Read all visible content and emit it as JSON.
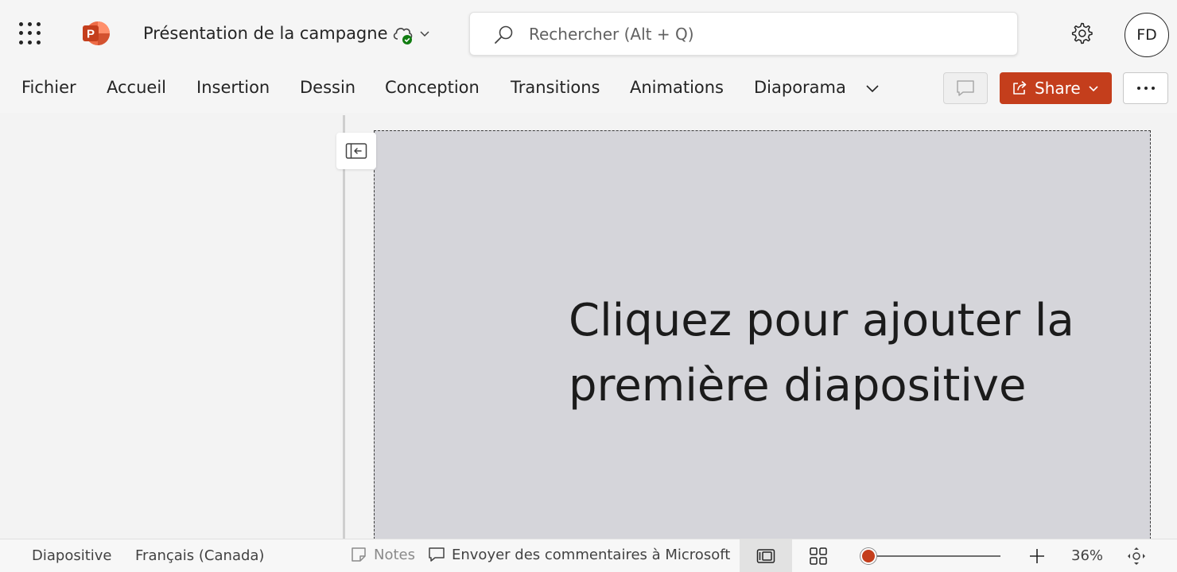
{
  "app": {
    "document_title": "Présentation de la campagne",
    "user_initials": "FD",
    "brand_color": "#c43e1c"
  },
  "search": {
    "placeholder": "Rechercher (Alt + Q)",
    "value": ""
  },
  "ribbon": {
    "tabs": [
      {
        "label": "Fichier"
      },
      {
        "label": "Accueil"
      },
      {
        "label": "Insertion"
      },
      {
        "label": "Dessin"
      },
      {
        "label": "Conception"
      },
      {
        "label": "Transitions"
      },
      {
        "label": "Animations"
      },
      {
        "label": "Diaporama"
      }
    ],
    "share_label": "Share"
  },
  "slide": {
    "title_placeholder": "Cliquez pour ajouter la première diapositive"
  },
  "status": {
    "slide_label": "Diapositive",
    "language": "Français (Canada)",
    "notes_label": "Notes",
    "feedback_label": "Envoyer des commentaires à Microsoft",
    "zoom_level": "36%",
    "zoom_fraction": 0.0
  },
  "icons": {
    "app_launcher": "waffle-icon",
    "app_logo": "powerpoint-logo-icon",
    "cloud_saved": "cloud-check-icon",
    "search": "search-icon",
    "settings": "gear-icon",
    "comments": "comment-icon",
    "share": "share-icon",
    "more": "ellipsis-icon",
    "collapse_pane": "collapse-pane-icon",
    "notes": "notes-icon",
    "feedback": "feedback-icon",
    "normal_view": "normal-view-icon",
    "slide_sorter": "slide-sorter-icon",
    "zoom_in": "plus-icon",
    "fit_to_window": "fit-window-icon"
  }
}
